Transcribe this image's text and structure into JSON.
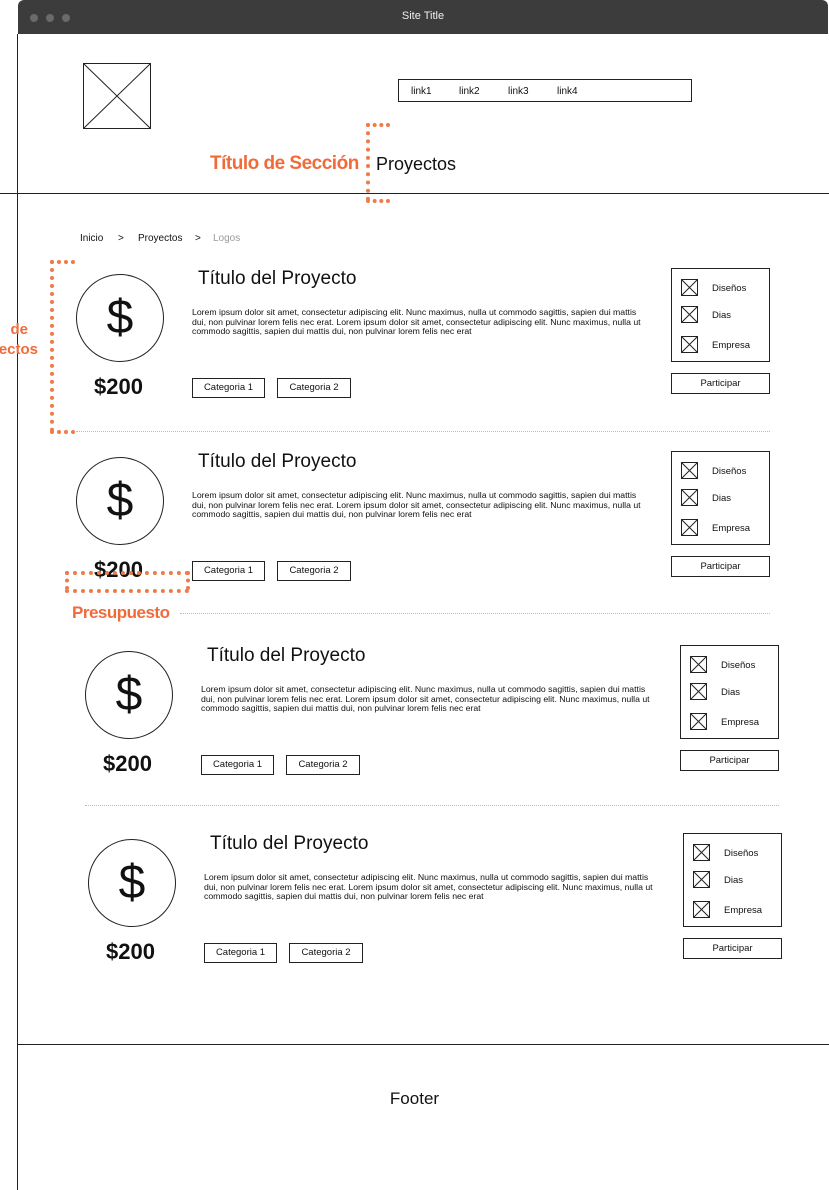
{
  "window": {
    "title": "Site Title"
  },
  "nav": {
    "links": [
      "link1",
      "link2",
      "link3",
      "link4"
    ]
  },
  "annotations": {
    "section_title_label": "Título de Sección",
    "budget_label": "Presupuesto",
    "projects_label_line1": "de",
    "projects_label_line2": "ectos",
    "color": "#f06b3a"
  },
  "section": {
    "title": "Proyectos"
  },
  "breadcrumb": {
    "items": [
      "Inicio",
      ">",
      "Proyectos",
      ">",
      "Logos"
    ]
  },
  "projects": [
    {
      "title": "Título del Proyecto",
      "description": "Lorem ipsum dolor sit amet, consectetur adipiscing elit. Nunc maximus, nulla ut commodo sagittis, sapien dui mattis dui, non pulvinar lorem felis nec erat. Lorem ipsum dolor sit amet, consectetur adipiscing elit. Nunc maximus, nulla ut commodo sagittis, sapien dui mattis dui, non pulvinar lorem felis nec erat",
      "icon": "$",
      "price": "$200",
      "categories": [
        "Categoria 1",
        "Categoria 2"
      ],
      "options": [
        "Diseños",
        "Dias",
        "Empresa"
      ],
      "action": "Participar"
    },
    {
      "title": "Título del Proyecto",
      "description": "Lorem ipsum dolor sit amet, consectetur adipiscing elit. Nunc maximus, nulla ut commodo sagittis, sapien dui mattis dui, non pulvinar lorem felis nec erat. Lorem ipsum dolor sit amet, consectetur adipiscing elit. Nunc maximus, nulla ut commodo sagittis, sapien dui mattis dui, non pulvinar lorem felis nec erat",
      "icon": "$",
      "price": "$200",
      "categories": [
        "Categoria 1",
        "Categoria 2"
      ],
      "options": [
        "Diseños",
        "Dias",
        "Empresa"
      ],
      "action": "Participar"
    },
    {
      "title": "Título del Proyecto",
      "description": "Lorem ipsum dolor sit amet, consectetur adipiscing elit. Nunc maximus, nulla ut commodo sagittis, sapien dui mattis dui, non pulvinar lorem felis nec erat. Lorem ipsum dolor sit amet, consectetur adipiscing elit. Nunc maximus, nulla ut commodo sagittis, sapien dui mattis dui, non pulvinar lorem felis nec erat",
      "icon": "$",
      "price": "$200",
      "categories": [
        "Categoria 1",
        "Categoria 2"
      ],
      "options": [
        "Diseños",
        "Dias",
        "Empresa"
      ],
      "action": "Participar"
    },
    {
      "title": "Título del Proyecto",
      "description": "Lorem ipsum dolor sit amet, consectetur adipiscing elit. Nunc maximus, nulla ut commodo sagittis, sapien dui mattis dui, non pulvinar lorem felis nec erat. Lorem ipsum dolor sit amet, consectetur adipiscing elit. Nunc maximus, nulla ut commodo sagittis, sapien dui mattis dui, non pulvinar lorem felis nec erat",
      "icon": "$",
      "price": "$200",
      "categories": [
        "Categoria 1",
        "Categoria 2"
      ],
      "options": [
        "Diseños",
        "Dias",
        "Empresa"
      ],
      "action": "Participar"
    }
  ],
  "footer": {
    "text": "Footer"
  }
}
